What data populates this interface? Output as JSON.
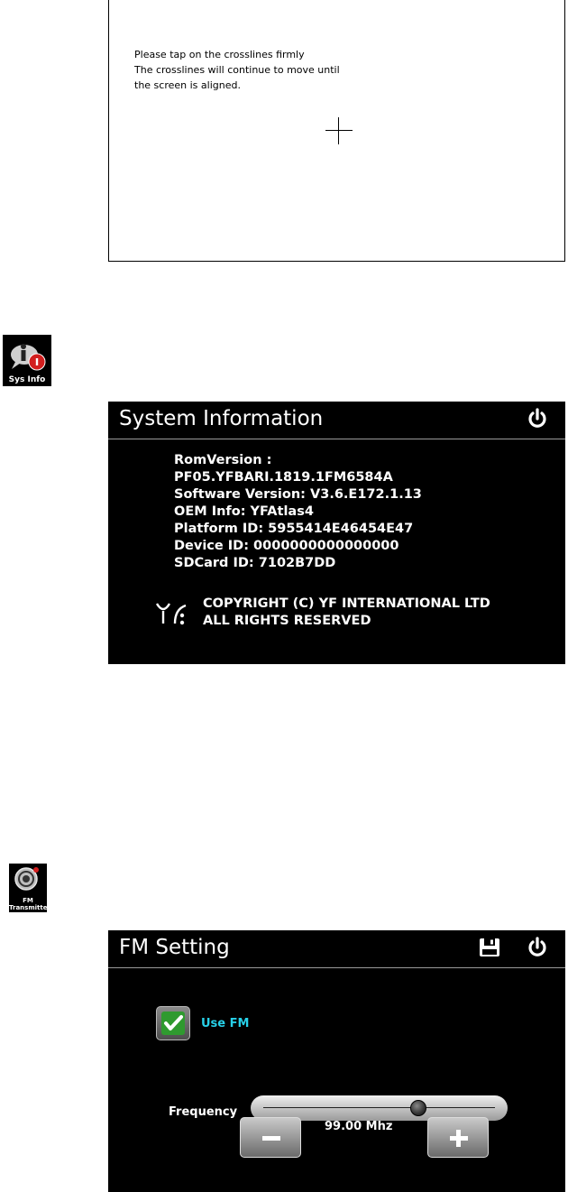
{
  "calibration": {
    "lines": [
      "Please tap on the crosslines firmly",
      "The crosslines will continue to move until",
      "the screen is aligned."
    ]
  },
  "sys_info_icon": {
    "label": "Sys Info"
  },
  "system_information": {
    "title": "System Information",
    "info_lines": [
      "RomVersion :",
      "PF05.YFBARI.1819.1FM6584A",
      "Software Version: V3.6.E172.1.13",
      "OEM Info: YFAtlas4",
      "Platform ID: 5955414E46454E47",
      "Device ID: 0000000000000000",
      "SDCard ID: 7102B7DD"
    ],
    "copyright_lines": [
      "COPYRIGHT (C) YF INTERNATIONAL LTD",
      "ALL RIGHTS RESERVED"
    ]
  },
  "fm_icon": {
    "label_line1": "FM",
    "label_line2": "Transmitter"
  },
  "fm_setting": {
    "title": "FM Setting",
    "use_fm_label": "Use FM",
    "use_fm_checked": true,
    "frequency_label": "Frequency",
    "frequency_value": "99.00 Mhz",
    "slider_position": 0.68
  },
  "colors": {
    "use_fm_text": "#27d0e8",
    "check_green": "#3fbf3f"
  }
}
